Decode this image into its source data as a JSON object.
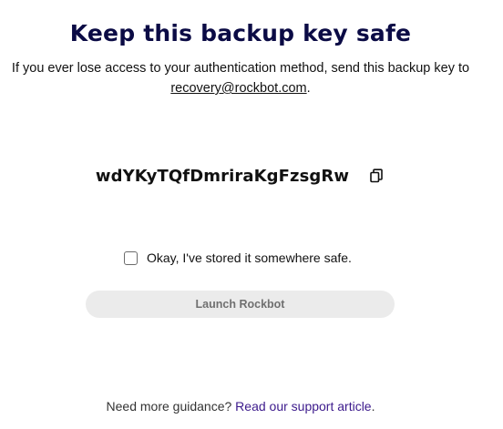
{
  "header": {
    "title": "Keep this backup key safe",
    "subtitle_prefix": "If you ever lose access to your authentication method, send this backup key to",
    "recovery_email": "recovery@rockbot.com",
    "subtitle_suffix": "."
  },
  "backup": {
    "key": "wdYKyTQfDmriraKgFzsgRw",
    "copy_icon": "copy-icon"
  },
  "confirm": {
    "label": "Okay, I've stored it somewhere safe.",
    "checked": false
  },
  "actions": {
    "launch_label": "Launch Rockbot"
  },
  "footer": {
    "guidance_prefix": "Need more guidance?",
    "support_link": "Read our support article",
    "guidance_suffix": "."
  },
  "colors": {
    "title": "#0b0b45",
    "link": "#3c1a8c",
    "button_bg": "#ebebeb",
    "button_text": "#707070"
  }
}
